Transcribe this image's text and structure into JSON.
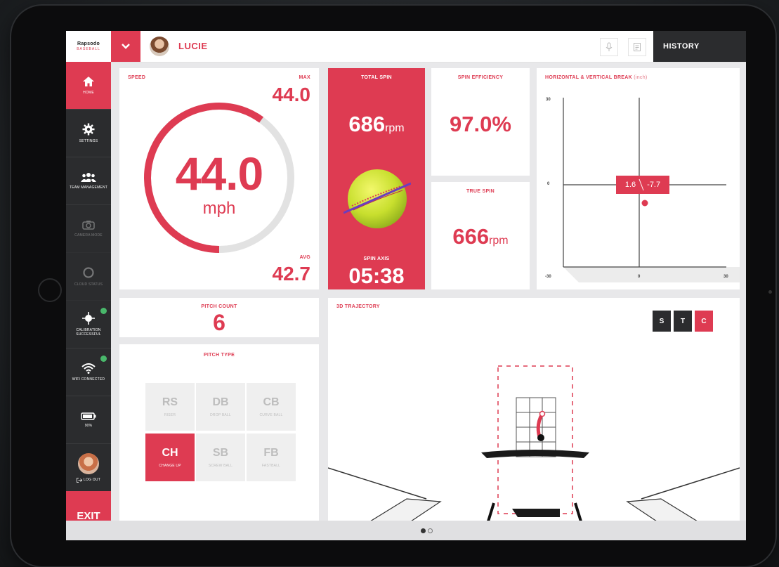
{
  "app": {
    "logo_line1": "Rapsodo",
    "logo_line2": "BASEBALL",
    "user_name": "LUCIE",
    "history_label": "HISTORY"
  },
  "sidebar": {
    "items": [
      {
        "label": "HOME",
        "icon": "home-icon",
        "state": "active"
      },
      {
        "label": "SETTINGS",
        "icon": "gear-icon",
        "state": "normal"
      },
      {
        "label": "TEAM MANAGEMENT",
        "icon": "team-icon",
        "state": "normal"
      },
      {
        "label": "CAMERA MODE",
        "icon": "camera-icon",
        "state": "disabled"
      },
      {
        "label": "CLOUD STATUS",
        "icon": "cloud-icon",
        "state": "disabled"
      },
      {
        "label": "CALIBRATION SUCCESSFUL",
        "icon": "calibration-icon",
        "state": "ok"
      },
      {
        "label": "WIFI CONNECTED",
        "icon": "wifi-icon",
        "state": "ok"
      },
      {
        "label": "90%",
        "icon": "battery-icon",
        "state": "normal"
      },
      {
        "label": "LOG OUT",
        "icon": "logout-icon",
        "state": "normal"
      }
    ],
    "exit_label": "EXIT"
  },
  "speed": {
    "label": "SPEED",
    "max_label": "MAX",
    "max_value": "44.0",
    "value": "44.0",
    "unit": "mph",
    "avg_label": "AVG",
    "avg_value": "42.7",
    "gauge_fraction": 0.6
  },
  "total_spin": {
    "label": "TOTAL SPIN",
    "value": "686",
    "unit": "rpm",
    "axis_label": "SPIN AXIS",
    "axis_value": "05:38"
  },
  "spin_efficiency": {
    "label": "SPIN EFFICIENCY",
    "value": "97.0%"
  },
  "true_spin": {
    "label": "TRUE SPIN",
    "value": "666",
    "unit": "rpm"
  },
  "break_chart": {
    "label": "HORIZONTAL & VERTICAL BREAK",
    "unit": "(inch)",
    "y_top": "30",
    "y_mid": "0",
    "x_left": "-30",
    "x_mid": "0",
    "x_right": "30",
    "readout_h": "1.6",
    "readout_v": "-7.7"
  },
  "pitch_count": {
    "label": "PITCH COUNT",
    "value": "6"
  },
  "pitch_type": {
    "label": "PITCH TYPE",
    "tiles": [
      {
        "code": "RS",
        "name": "RISER",
        "selected": false
      },
      {
        "code": "DB",
        "name": "DROP BALL",
        "selected": false
      },
      {
        "code": "CB",
        "name": "CURVE BALL",
        "selected": false
      },
      {
        "code": "CH",
        "name": "CHANGE UP",
        "selected": true
      },
      {
        "code": "SB",
        "name": "SCREW BALL",
        "selected": false
      },
      {
        "code": "FB",
        "name": "FASTBALL",
        "selected": false
      }
    ]
  },
  "trajectory": {
    "label": "3D TRAJECTORY",
    "views": [
      "S",
      "T",
      "C"
    ],
    "selected_view": "C"
  },
  "pager": {
    "pages": 2,
    "current": 1
  },
  "colors": {
    "accent": "#de3b52",
    "dark": "#2b2c2e",
    "ok": "#49b86b"
  }
}
